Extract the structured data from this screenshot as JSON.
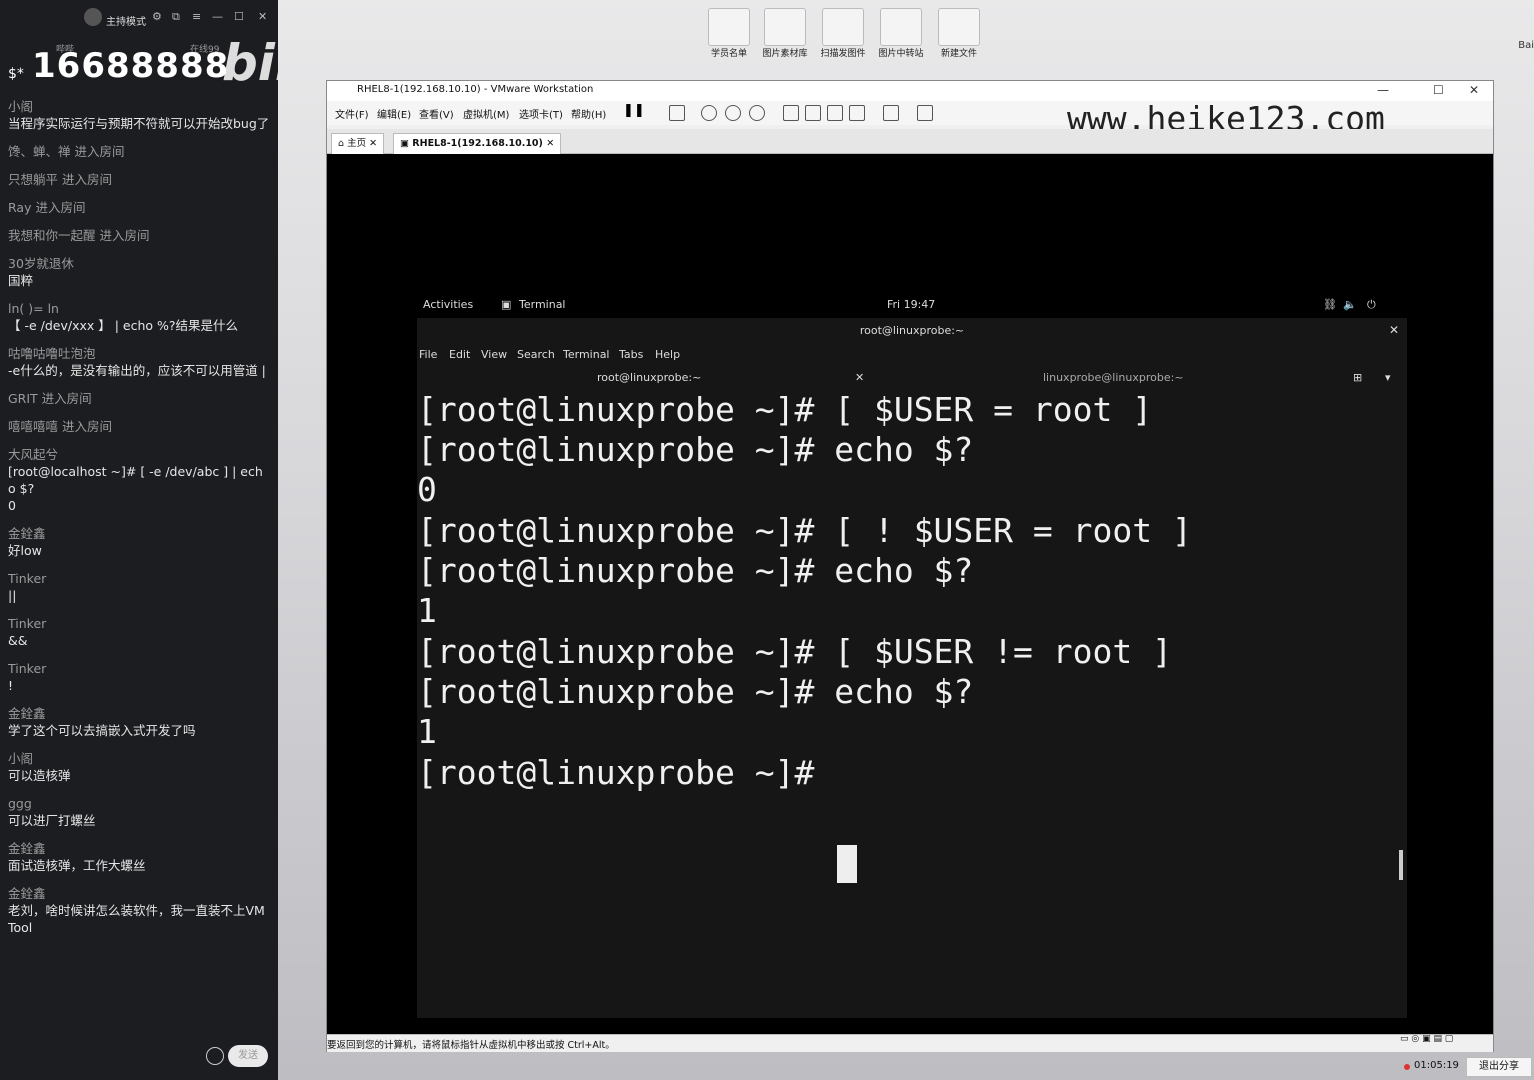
{
  "chat": {
    "host_mode": "主持模式",
    "counter_label": "哔哔",
    "online_label": "在线99",
    "prefix": "$*",
    "big_message": "16688888",
    "logo": "bilibili",
    "messages": [
      {
        "who": "小阁",
        "txt": "当程序实际运行与预期不符就可以开始改bug了"
      },
      {
        "join": "馋、蝉、禅 进入房间"
      },
      {
        "join": "只想躺平 进入房间"
      },
      {
        "join": "Ray 进入房间"
      },
      {
        "join": "我想和你一起醒 进入房间"
      },
      {
        "who": "30岁就退休",
        "txt": "国粹"
      },
      {
        "who": "ln(     )=      ln",
        "txt": "【 -e /dev/xxx 】 | echo %?结果是什么"
      },
      {
        "who": "咕噜咕噜吐泡泡",
        "txt": "-e什么的，是没有输出的，应该不可以用管道 |"
      },
      {
        "join": "GRIT 进入房间"
      },
      {
        "join": "嘻嘻嘻嘻 进入房间"
      },
      {
        "who": "大风起兮",
        "txt": "[root@localhost ~]# [ -e /dev/abc ] | echo $?\n0"
      },
      {
        "who": "金銓鑫",
        "txt": "好low"
      },
      {
        "who": "Tinker",
        "txt": "||"
      },
      {
        "who": "Tinker",
        "txt": "&&"
      },
      {
        "who": "Tinker",
        "txt": "!"
      },
      {
        "who": "金銓鑫",
        "txt": "学了这个可以去搞嵌入式开发了吗"
      },
      {
        "who": "小阁",
        "txt": "可以造核弹"
      },
      {
        "who": "ggg",
        "txt": "可以进厂打螺丝"
      },
      {
        "who": "金銓鑫",
        "txt": "面试造核弹，工作大螺丝"
      },
      {
        "who": "金銓鑫",
        "txt": "老刘，啥时候讲怎么装软件，我一直装不上VM Tool"
      }
    ],
    "send_label": "发送"
  },
  "desktop": {
    "icons": [
      "学员名单",
      "图片素材库",
      "扫描发图件",
      "图片中转站",
      "新建文件"
    ],
    "edge_label": "Bai"
  },
  "vmware": {
    "title": "RHEL8-1(192.168.10.10) - VMware Workstation",
    "menus": [
      "文件(F)",
      "编辑(E)",
      "查看(V)",
      "虚拟机(M)",
      "选项卡(T)",
      "帮助(H)"
    ],
    "tabs": [
      "主页",
      "RHEL8-1(192.168.10.10)"
    ],
    "status": "要返回到您的计算机，请将鼠标指针从虚拟机中移出或按 Ctrl+Alt。",
    "watermark": "www.heike123.com"
  },
  "gnome": {
    "activities": "Activities",
    "app": "Terminal",
    "clock": "Fri 19:47"
  },
  "terminal": {
    "title": "root@linuxprobe:~",
    "menu": [
      "File",
      "Edit",
      "View",
      "Search",
      "Terminal",
      "Tabs",
      "Help"
    ],
    "tabs": [
      "root@linuxprobe:~",
      "linuxprobe@linuxprobe:~"
    ],
    "lines": [
      "[root@linuxprobe ~]# [ $USER = root ]",
      "[root@linuxprobe ~]# echo $?",
      "0",
      "[root@linuxprobe ~]# [ ! $USER = root ]",
      "[root@linuxprobe ~]# echo $?",
      "1",
      "[root@linuxprobe ~]# [ $USER != root ]",
      "[root@linuxprobe ~]# echo $?",
      "1",
      "[root@linuxprobe ~]# "
    ]
  },
  "taskbar": {
    "rec_time": "01:05:19",
    "exit_share": "退出分享"
  }
}
